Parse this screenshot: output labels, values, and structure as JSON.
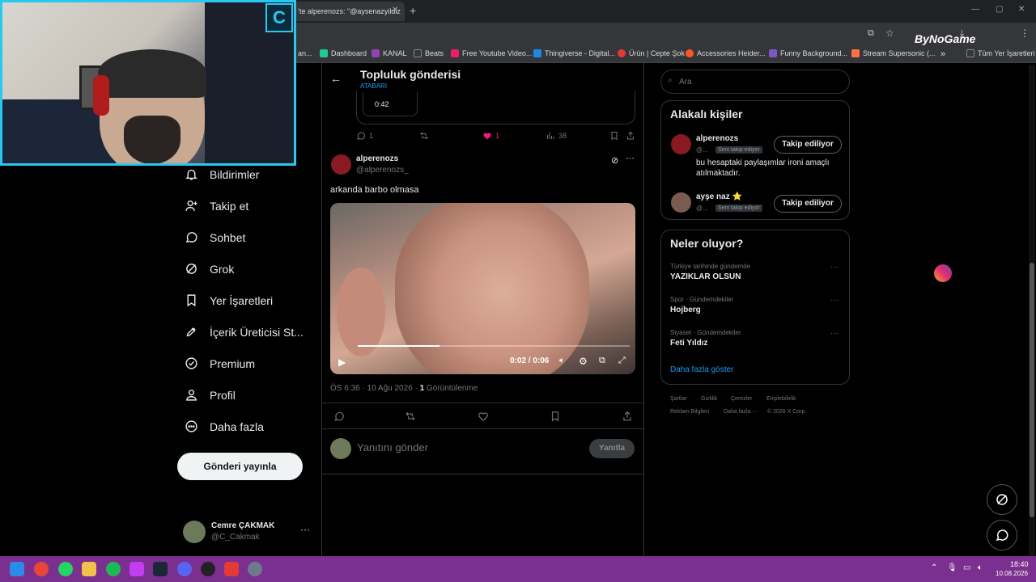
{
  "browser": {
    "tab_title": "’te alperenozs: \"@aysenazyildiz",
    "bookmarks": [
      {
        "label": "an...",
        "color": "#35363a"
      },
      {
        "label": "Dashboard",
        "color": "#20c997"
      },
      {
        "label": "KANAL",
        "color": "#8e44ad"
      },
      {
        "label": "Beats",
        "color": "#888888"
      },
      {
        "label": "Free Youtube Video...",
        "color": "#e91e63"
      },
      {
        "label": "Thingiverse - Digital...",
        "color": "#1e88e5"
      },
      {
        "label": "Ürün | Cepte Şok",
        "color": "#e53935"
      },
      {
        "label": "Accessories Heider...",
        "color": "#ff5722"
      },
      {
        "label": "Funny Background...",
        "color": "#7e57c2"
      },
      {
        "label": "Stream Supersonic (...",
        "color": "#ff7043"
      }
    ],
    "bookmarks_overflow": "»",
    "all_bookmarks": "Tüm Yer İşaretleri",
    "overlay_brand": "ByNoGame"
  },
  "nav": {
    "items": [
      {
        "label": "Bildirimler",
        "icon": "bell-icon"
      },
      {
        "label": "Takip et",
        "icon": "follow-icon"
      },
      {
        "label": "Sohbet",
        "icon": "chat-icon"
      },
      {
        "label": "Grok",
        "icon": "grok-icon"
      },
      {
        "label": "Yer İşaretleri",
        "icon": "bookmark-icon"
      },
      {
        "label": "İçerik Üreticisi St...",
        "icon": "rocket-icon"
      },
      {
        "label": "Premium",
        "icon": "premium-icon"
      },
      {
        "label": "Profil",
        "icon": "profile-icon"
      },
      {
        "label": "Daha fazla",
        "icon": "more-icon"
      }
    ],
    "post_button": "Gönderi yayınla",
    "account_name": "Cemre ÇAKMAK",
    "account_handle": "@C_Cakmak"
  },
  "main": {
    "header_title": "Topluluk gönderisi",
    "header_sub": "ATABARI",
    "quoted_time": "0:42",
    "actions_top": {
      "replies": "1",
      "likes": "1",
      "views": "38"
    },
    "author_name": "alperenozs",
    "author_handle": "@alperenozs_",
    "text": "arkanda barbo olmasa",
    "video_time": "0:02 / 0:06",
    "video_progress": 0.3,
    "meta_time": "ÖS 6:36 · 10 Ağu 2026 · ",
    "meta_views_count": "1",
    "meta_views_label": " Görüntülenme",
    "reply_placeholder": "Yanıtını gönder",
    "reply_button": "Yanıtla"
  },
  "right": {
    "search_placeholder": "Ara",
    "relevant_title": "Alakalı kişiler",
    "people": [
      {
        "name": "alperenozs",
        "handle": "@...",
        "badge": "Seni takip ediyor",
        "bio": "bu hesaptaki paylaşımlar ironi amaçlı atılmaktadır.",
        "button": "Takip ediliyor"
      },
      {
        "name": "ayşe naz ⭐",
        "handle": "@...",
        "badge": "Seni takip ediyor",
        "bio": "",
        "button": "Takip ediliyor"
      }
    ],
    "trends_title": "Neler oluyor?",
    "trends": [
      {
        "sub": "Türkiye tarihinde gündemde",
        "name": "YAZIKLAR OLSUN"
      },
      {
        "sub": "Spor · Gündemdekiler",
        "name": "Hojberg"
      },
      {
        "sub": "Siyaset · Gündemdekiler",
        "name": "Feti Yıldız"
      }
    ],
    "show_more": "Daha fazla göster",
    "footer_row1": [
      "Şartlar",
      "Gizlilik",
      "Çerezler",
      "Erişilebilirlik"
    ],
    "footer_row2": [
      "Reklam Bilgileri",
      "Daha fazla ···",
      "© 2026 X Corp."
    ]
  },
  "taskbar": {
    "time": "18:40",
    "date": "10.08.2026"
  },
  "colors": {
    "accent": "#1d9bf0",
    "like": "#f91880",
    "taskbar": "#7b2f8e",
    "webcam_border": "#28c8f0"
  }
}
